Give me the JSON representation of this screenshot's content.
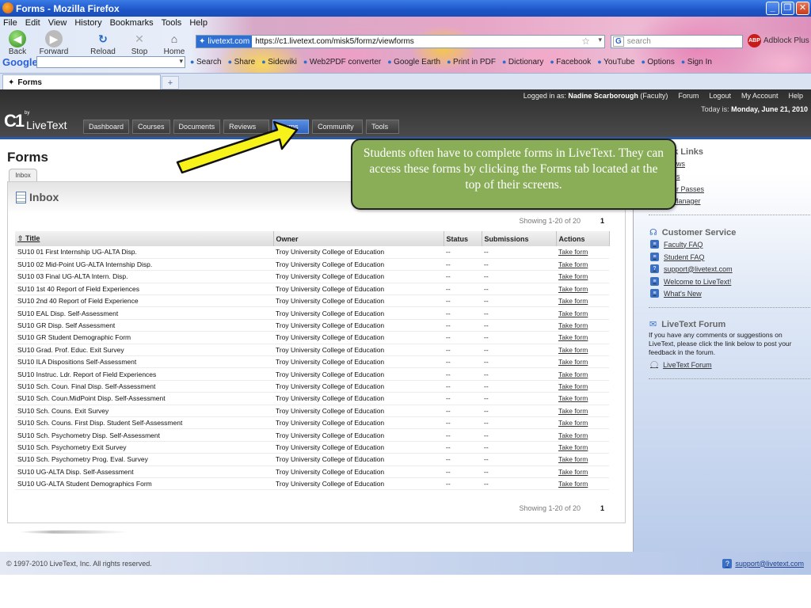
{
  "window": {
    "title": "Forms - Mozilla Firefox"
  },
  "menu": [
    "File",
    "Edit",
    "View",
    "History",
    "Bookmarks",
    "Tools",
    "Help"
  ],
  "nav": {
    "back": "Back",
    "forward": "Forward",
    "reload": "Reload",
    "stop": "Stop",
    "home": "Home"
  },
  "address": {
    "site": "livetext.com",
    "url": "https://c1.livetext.com/misk5/formz/viewforms"
  },
  "search": {
    "placeholder": "search",
    "engine": "G"
  },
  "addons": {
    "abp_badge": "ABP",
    "abp_label": "Adblock Plus"
  },
  "googlebar": {
    "logo": "Google",
    "items": [
      "Search",
      "Share",
      "Sidewiki",
      "Web2PDF converter",
      "Google Earth",
      "Print in PDF",
      "Dictionary",
      "Facebook",
      "YouTube",
      "Options",
      "Sign In"
    ]
  },
  "browser_tab": {
    "label": "Forms",
    "new_tab": "+"
  },
  "lt": {
    "logged_in_prefix": "Logged in as:",
    "user_name": "Nadine Scarborough",
    "user_role": "(Faculty)",
    "top_links": [
      "Forum",
      "Logout",
      "My Account",
      "Help"
    ],
    "today_prefix": "Today is:",
    "today": "Monday, June 21, 2010",
    "logo_by": "by",
    "logo_c1": "C1",
    "logo_text": "LiveText",
    "tabs": [
      "Dashboard",
      "Courses",
      "Documents",
      "Reviews",
      "Forms",
      "Community",
      "Tools"
    ],
    "active_tab": "Forms"
  },
  "main": {
    "title": "Forms",
    "subtab": "Inbox",
    "inbox_title": "Inbox",
    "showing": "Showing 1-20 of 20",
    "page": "1",
    "columns": [
      "Title",
      "Owner",
      "Status",
      "Submissions",
      "Actions"
    ],
    "rows": [
      [
        "SU10 01 First Internship UG-ALTA Disp.",
        "Troy University College of Education",
        "--",
        "--",
        "Take form"
      ],
      [
        "SU10 02 Mid-Point UG-ALTA Internship Disp.",
        "Troy University College of Education",
        "--",
        "--",
        "Take form"
      ],
      [
        "SU10 03 Final UG-ALTA Intern. Disp.",
        "Troy University College of Education",
        "--",
        "--",
        "Take form"
      ],
      [
        "SU10 1st 40 Report of Field Experiences",
        "Troy University College of Education",
        "--",
        "--",
        "Take form"
      ],
      [
        "SU10 2nd 40 Report of Field Experience",
        "Troy University College of Education",
        "--",
        "--",
        "Take form"
      ],
      [
        "SU10 EAL Disp. Self-Assessment",
        "Troy University College of Education",
        "--",
        "--",
        "Take form"
      ],
      [
        "SU10 GR Disp. Self Assessment",
        "Troy University College of Education",
        "--",
        "--",
        "Take form"
      ],
      [
        "SU10 GR Student Demographic Form",
        "Troy University College of Education",
        "--",
        "--",
        "Take form"
      ],
      [
        "SU10 Grad. Prof. Educ. Exit Survey",
        "Troy University College of Education",
        "--",
        "--",
        "Take form"
      ],
      [
        "SU10 ILA Dispositions Self-Assessment",
        "Troy University College of Education",
        "--",
        "--",
        "Take form"
      ],
      [
        "SU10 Instruc. Ldr. Report of Field Experiences",
        "Troy University College of Education",
        "--",
        "--",
        "Take form"
      ],
      [
        "SU10 Sch. Coun. Final Disp. Self-Assessment",
        "Troy University College of Education",
        "--",
        "--",
        "Take form"
      ],
      [
        "SU10 Sch. Coun.MidPoint Disp. Self-Assessment",
        "Troy University College of Education",
        "--",
        "--",
        "Take form"
      ],
      [
        "SU10 Sch. Couns. Exit Survey",
        "Troy University College of Education",
        "--",
        "--",
        "Take form"
      ],
      [
        "SU10 Sch. Couns. First Disp. Student Self-Assessment",
        "Troy University College of Education",
        "--",
        "--",
        "Take form"
      ],
      [
        "SU10 Sch. Psychometry Disp. Self-Assessment",
        "Troy University College of Education",
        "--",
        "--",
        "Take form"
      ],
      [
        "SU10 Sch. Psychometry Exit Survey",
        "Troy University College of Education",
        "--",
        "--",
        "Take form"
      ],
      [
        "SU10 Sch. Psychometry Prog. Eval. Survey",
        "Troy University College of Education",
        "--",
        "--",
        "Take form"
      ],
      [
        "SU10 UG-ALTA Disp. Self-Assessment",
        "Troy University College of Education",
        "--",
        "--",
        "Take form"
      ],
      [
        "SU10 UG-ALTA Student Demographics Form",
        "Troy University College of Education",
        "--",
        "--",
        "Take form"
      ]
    ]
  },
  "callout": {
    "text": "Students often have to complete forms in LiveText. They can access these forms by clicking the Forms tab located at the top of their screens."
  },
  "sidebar": {
    "quick_links_title": "ck Links",
    "quick_links": [
      "ews",
      "ps",
      "or Passes",
      "Manager"
    ],
    "cs_title": "Customer Service",
    "cs_links": [
      "Faculty FAQ",
      "Student FAQ",
      "support@livetext.com",
      "Welcome to LiveText!",
      "What's New"
    ],
    "forum_title": "LiveText Forum",
    "forum_text": "If you have any comments or suggestions on LiveText, please click the link below to post your feedback in the forum.",
    "forum_link": "LiveText Forum"
  },
  "footer": {
    "copyright": "© 1997-2010 LiveText, Inc. All rights reserved.",
    "support": "support@livetext.com"
  },
  "colors": {
    "callout": "#8aae58",
    "arrow": "#f7f31a",
    "active_tab": "#2f63c4",
    "header": "#3a3a3a"
  }
}
